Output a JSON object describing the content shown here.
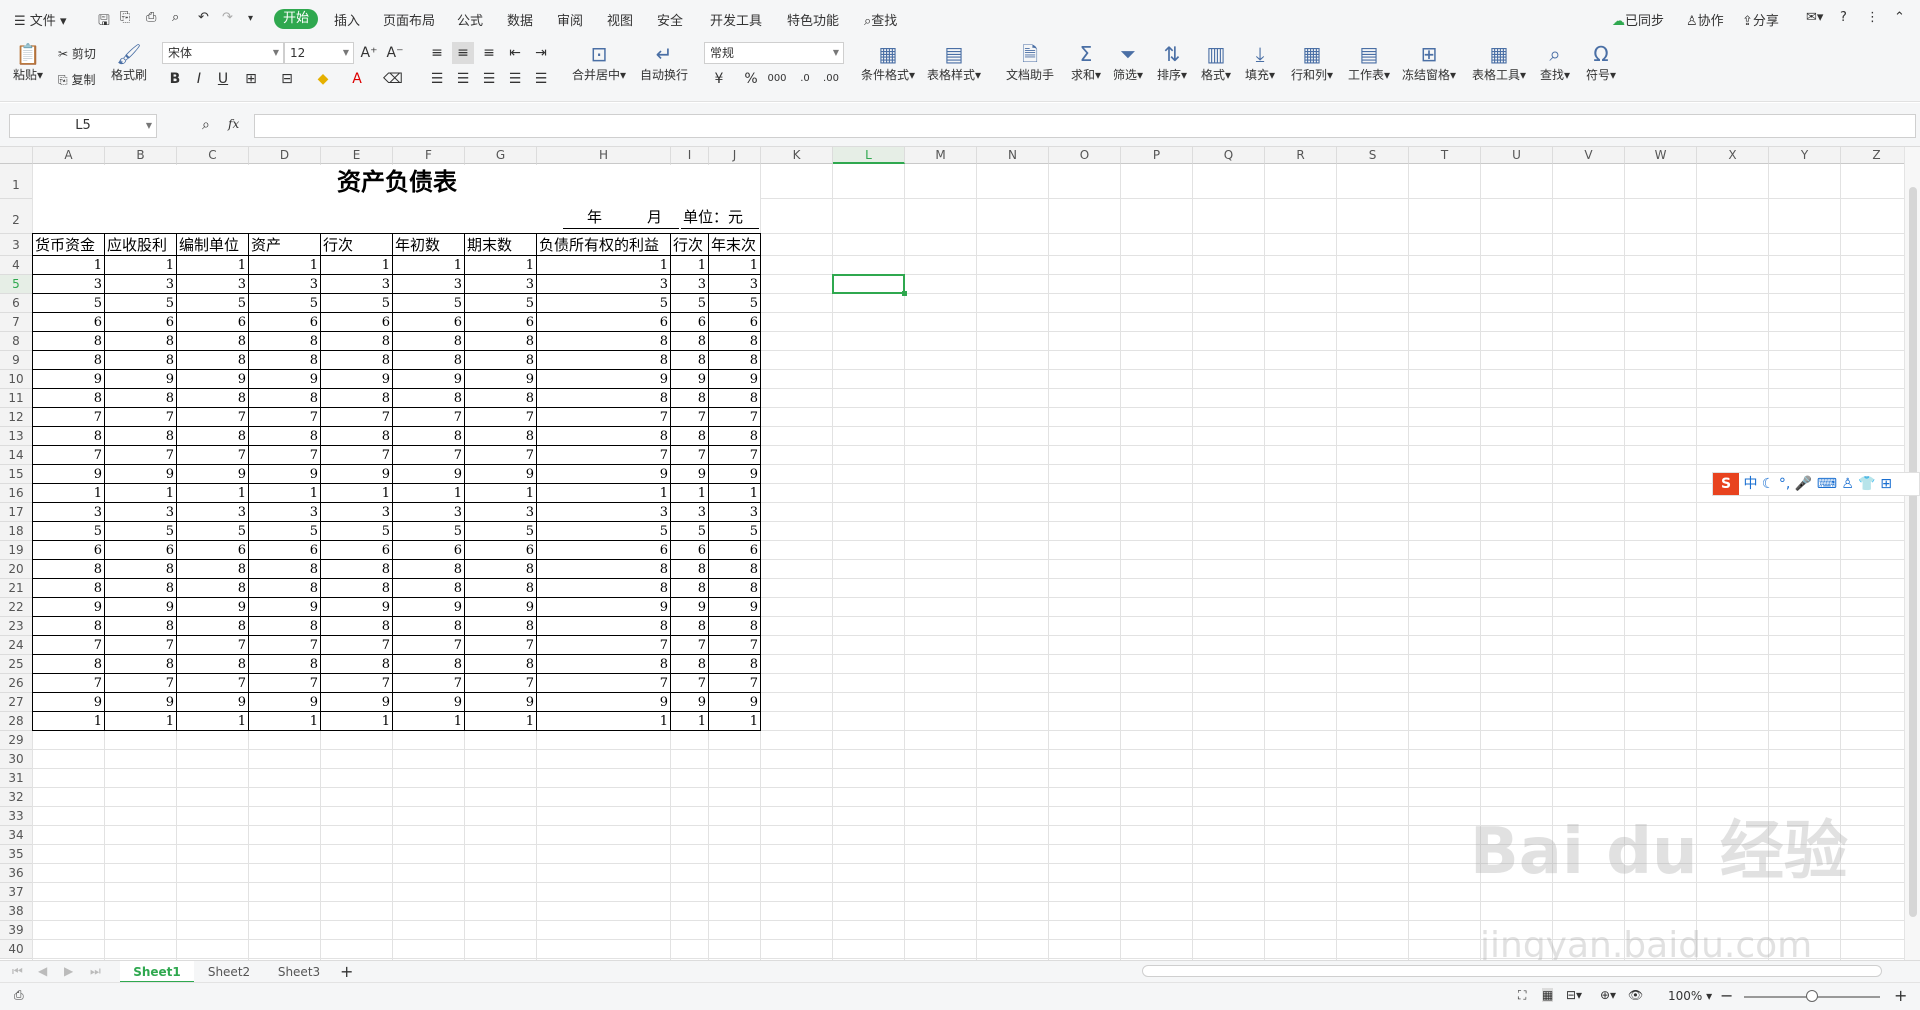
{
  "menu": {
    "file": "文件",
    "tabs": [
      "开始",
      "插入",
      "页面布局",
      "公式",
      "数据",
      "审阅",
      "视图",
      "安全",
      "开发工具",
      "特色功能"
    ],
    "search": "查找",
    "sync": "已同步",
    "collab": "协作",
    "share": "分享"
  },
  "ribbon": {
    "paste": "粘贴",
    "cut": "剪切",
    "copy": "复制",
    "format_painter": "格式刷",
    "font": "宋体",
    "font_size": "12",
    "number_format": "常规",
    "merge": "合并居中",
    "wrap": "自动换行",
    "cond_format": "条件格式",
    "table_style": "表格样式",
    "doc_helper": "文档助手",
    "sum": "求和",
    "filter": "筛选",
    "sort": "排序",
    "format": "格式",
    "fill": "填充",
    "rowcol": "行和列",
    "worksheet": "工作表",
    "freeze": "冻结窗格",
    "table_tools": "表格工具",
    "find": "查找",
    "symbol": "符号",
    "bold": "B",
    "italic": "I",
    "underline": "U"
  },
  "formula_bar": {
    "name_box": "L5",
    "fx": "fx",
    "value": ""
  },
  "columns": [
    "A",
    "B",
    "C",
    "D",
    "E",
    "F",
    "G",
    "H",
    "I",
    "J",
    "K",
    "L",
    "M",
    "N",
    "O",
    "P",
    "Q",
    "R",
    "S",
    "T",
    "U",
    "V",
    "W",
    "X",
    "Y",
    "Z"
  ],
  "rows": [
    "1",
    "2",
    "3",
    "4",
    "5",
    "6",
    "7",
    "8",
    "9",
    "10",
    "11",
    "12",
    "13",
    "14",
    "15",
    "16",
    "17",
    "18",
    "19",
    "20",
    "21",
    "22",
    "23",
    "24",
    "25",
    "26",
    "27",
    "28",
    "29",
    "30",
    "31",
    "32",
    "33",
    "34",
    "35",
    "36",
    "37",
    "38",
    "39",
    "40"
  ],
  "sheet": {
    "title": "资产负债表",
    "year": "年",
    "month": "月",
    "unit": "单位：元",
    "headers": [
      "货币资金",
      "应收股利",
      "编制单位",
      "资产",
      "行次",
      "年初数",
      "期末数",
      "负债所有权的利益",
      "行次",
      "年末次"
    ],
    "values": [
      1,
      3,
      5,
      6,
      8,
      8,
      9,
      8,
      7,
      8,
      7,
      9,
      1,
      3,
      5,
      6,
      8,
      8,
      9,
      8,
      7,
      8,
      7,
      9,
      1
    ]
  },
  "sheet_tabs": [
    "Sheet1",
    "Sheet2",
    "Sheet3"
  ],
  "status": {
    "zoom": "100%"
  },
  "watermark": {
    "brand": "Bai du 经验",
    "url": "jingyan.baidu.com"
  },
  "ime": {
    "label": "中"
  }
}
